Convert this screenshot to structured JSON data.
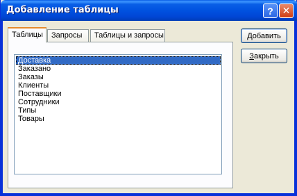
{
  "window": {
    "title": "Добавление таблицы"
  },
  "titlebar_buttons": {
    "help": "?",
    "close": "✕"
  },
  "tabs": [
    {
      "label": "Таблицы",
      "active": true
    },
    {
      "label": "Запросы",
      "active": false
    },
    {
      "label": "Таблицы и запросы",
      "active": false
    }
  ],
  "list": {
    "items": [
      "Доставка",
      "Заказано",
      "Заказы",
      "Клиенты",
      "Поставщики",
      "Сотрудники",
      "Типы",
      "Товары"
    ],
    "selected_index": 0
  },
  "buttons": {
    "add": {
      "accel": "Д",
      "rest": "обавить"
    },
    "close": {
      "accel": "З",
      "rest": "акрыть"
    }
  },
  "colors": {
    "titlebar": "#0052e0",
    "selection": "#316ac5",
    "tab_highlight": "#e68b2c"
  }
}
